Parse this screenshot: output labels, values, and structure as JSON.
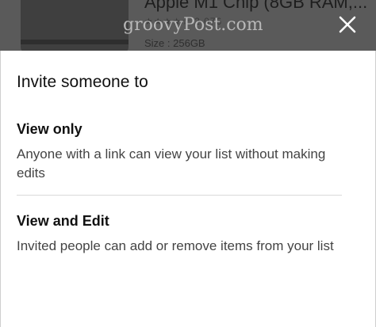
{
  "background_product": {
    "title": "Apple M1 Chip (8GB RAM,...",
    "rating_stars": "★★★★☆ 2,076",
    "size": "Size : 256GB"
  },
  "watermark": "groovyPost.com",
  "close_icon": "close-icon",
  "sheet": {
    "title": "Invite someone to",
    "options": [
      {
        "title": "View only",
        "description": "Anyone with a link can view your list without making edits"
      },
      {
        "title": "View and Edit",
        "description": "Invited people can add or remove items from your list"
      }
    ]
  },
  "colors": {
    "backdrop": "#5a5a5a",
    "sheet_background": "#ffffff",
    "title_text": "#111111",
    "body_text": "#444444"
  }
}
